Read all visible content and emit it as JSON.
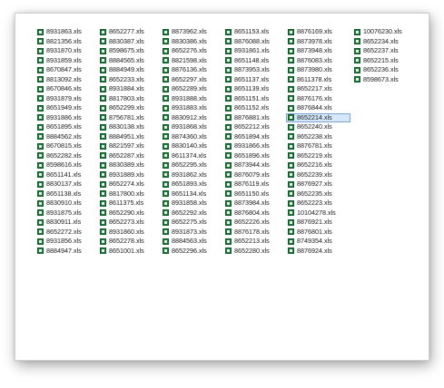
{
  "colors": {
    "icon": "#1e7a3c",
    "selection_bg": "#d6e9fb",
    "selection_border": "#7da2ce"
  },
  "icon_name": "excel-file-icon",
  "selected_file": "8652214.xls",
  "columns": [
    [
      "8931863.xls",
      "8821356.xls",
      "8931870.xls",
      "8931859.xls",
      "8670847.xls",
      "8813092.xls",
      "8670846.xls",
      "8931879.xls",
      "8651949.xls",
      "8931886.xls",
      "8651895.xls",
      "8884562.xls",
      "8670815.xls",
      "8652282.xls",
      "8598616.xls",
      "8651141.xls",
      "8830137.xls",
      "8651138.xls",
      "8830910.xls",
      "8931875.xls",
      "8830911.xls",
      "8652272.xls",
      "8931856.xls",
      "8884947.xls"
    ],
    [
      "8652277.xls",
      "8830387.xls",
      "8598675.xls",
      "8884565.xls",
      "8884949.xls",
      "8652233.xls",
      "8931884.xls",
      "8817803.xls",
      "8652299.xls",
      "8756781.xls",
      "8830138.xls",
      "8884951.xls",
      "8821597.xls",
      "8652287.xls",
      "8830389.xls",
      "8931889.xls",
      "8652274.xls",
      "8817800.xls",
      "8611375.xls",
      "8652290.xls",
      "8652273.xls",
      "8931860.xls",
      "8652278.xls",
      "8651001.xls"
    ],
    [
      "8873962.xls",
      "8830386.xls",
      "8652276.xls",
      "8821598.xls",
      "8876136.xls",
      "8652297.xls",
      "8652289.xls",
      "8931888.xls",
      "8931883.xls",
      "8830912.xls",
      "8931868.xls",
      "8874360.xls",
      "8830140.xls",
      "8611374.xls",
      "8652295.xls",
      "8931862.xls",
      "8651893.xls",
      "8651134.xls",
      "8931858.xls",
      "8652292.xls",
      "8652275.xls",
      "8931873.xls",
      "8884563.xls",
      "8652296.xls"
    ],
    [
      "8651153.xls",
      "8876088.xls",
      "8931861.xls",
      "8651148.xls",
      "8873953.xls",
      "8651137.xls",
      "8651139.xls",
      "8651151.xls",
      "8651152.xls",
      "8876881.xls",
      "8652212.xls",
      "8651894.xls",
      "8931866.xls",
      "8651896.xls",
      "8873944.xls",
      "8876079.xls",
      "8876119.xls",
      "8651150.xls",
      "8873984.xls",
      "8876804.xls",
      "8652226.xls",
      "8876178.xls",
      "8652213.xls",
      "8652280.xls"
    ],
    [
      "8876169.xls",
      "8873978.xls",
      "8873948.xls",
      "8876083.xls",
      "8873980.xls",
      "8611378.xls",
      "8652217.xls",
      "8876176.xls",
      "8876844.xls",
      "8652214.xls",
      "8652240.xls",
      "8652238.xls",
      "8876781.xls",
      "8652219.xls",
      "8652216.xls",
      "8652239.xls",
      "8876927.xls",
      "8652235.xls",
      "8652223.xls",
      "10104278.xls",
      "8876921.xls",
      "8876801.xls",
      "8749354.xls",
      "8876924.xls"
    ],
    [
      "10076230.xls",
      "8652234.xls",
      "8652237.xls",
      "8652215.xls",
      "8652236.xls",
      "8598673.xls"
    ]
  ]
}
